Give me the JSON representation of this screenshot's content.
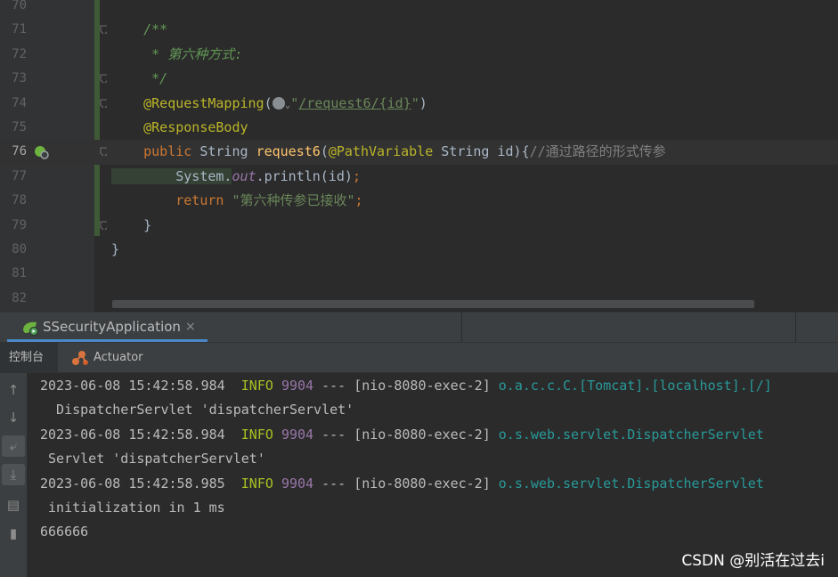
{
  "editor": {
    "lines": [
      {
        "num": "70",
        "parts": []
      },
      {
        "num": "71",
        "parts": [
          {
            "c": "cm",
            "t": "    /**"
          }
        ]
      },
      {
        "num": "72",
        "parts": [
          {
            "c": "cm",
            "t": "     * 第六种方式:"
          }
        ]
      },
      {
        "num": "73",
        "parts": [
          {
            "c": "cm",
            "t": "     */"
          }
        ]
      },
      {
        "num": "74",
        "parts": [
          {
            "c": "ann",
            "t": "    @RequestMapping"
          },
          {
            "c": "",
            "t": "("
          },
          {
            "c": "icon",
            "t": ""
          },
          {
            "c": "str",
            "t": "\""
          },
          {
            "c": "link",
            "t": "/request6/{id}"
          },
          {
            "c": "str",
            "t": "\""
          },
          {
            "c": "",
            "t": ")"
          }
        ]
      },
      {
        "num": "75",
        "parts": [
          {
            "c": "ann",
            "t": "    @ResponseBody"
          }
        ]
      },
      {
        "num": "76",
        "parts": [
          {
            "c": "kw",
            "t": "    public "
          },
          {
            "c": "",
            "t": "String "
          },
          {
            "c": "fn",
            "t": "request6"
          },
          {
            "c": "",
            "t": "("
          },
          {
            "c": "ann",
            "t": "@PathVariable "
          },
          {
            "c": "",
            "t": "String id){"
          },
          {
            "c": "lc",
            "t": "//通过路径的形式传参"
          }
        ]
      },
      {
        "num": "77",
        "parts": [
          {
            "c": "hl",
            "t": "        System."
          },
          {
            "c": "field",
            "t": "out"
          },
          {
            "c": "",
            "t": ".println(id)"
          },
          {
            "c": "kw",
            "t": ";"
          }
        ]
      },
      {
        "num": "78",
        "parts": [
          {
            "c": "kw",
            "t": "        return "
          },
          {
            "c": "str",
            "t": "\"第六种传参已接收\""
          },
          {
            "c": "kw",
            "t": ";"
          }
        ]
      },
      {
        "num": "79",
        "parts": [
          {
            "c": "",
            "t": "    }"
          }
        ]
      },
      {
        "num": "80",
        "parts": [
          {
            "c": "",
            "t": "}"
          }
        ]
      },
      {
        "num": "81",
        "parts": []
      },
      {
        "num": "82",
        "parts": []
      }
    ],
    "current_line": "76"
  },
  "run_tab": {
    "label": "SSecurityApplication",
    "close": "×"
  },
  "subtabs": {
    "console": "控制台",
    "actuator": "Actuator"
  },
  "console": {
    "lines": [
      [
        {
          "c": "ts",
          "t": "2023-06-08 15:42:58.984  "
        },
        {
          "c": "info",
          "t": "INFO "
        },
        {
          "c": "pid",
          "t": "9904"
        },
        {
          "c": "ts",
          "t": " --- [nio-8080-exec-2] "
        },
        {
          "c": "logger",
          "t": "o.a.c.c.C.[Tomcat].[localhost].[/]"
        }
      ],
      [
        {
          "c": "ts",
          "t": "  DispatcherServlet 'dispatcherServlet'"
        }
      ],
      [
        {
          "c": "ts",
          "t": "2023-06-08 15:42:58.984  "
        },
        {
          "c": "info",
          "t": "INFO "
        },
        {
          "c": "pid",
          "t": "9904"
        },
        {
          "c": "ts",
          "t": " --- [nio-8080-exec-2] "
        },
        {
          "c": "logger",
          "t": "o.s.web.servlet.DispatcherServlet"
        }
      ],
      [
        {
          "c": "ts",
          "t": " Servlet 'dispatcherServlet'"
        }
      ],
      [
        {
          "c": "ts",
          "t": "2023-06-08 15:42:58.985  "
        },
        {
          "c": "info",
          "t": "INFO "
        },
        {
          "c": "pid",
          "t": "9904"
        },
        {
          "c": "ts",
          "t": " --- [nio-8080-exec-2] "
        },
        {
          "c": "logger",
          "t": "o.s.web.servlet.DispatcherServlet"
        }
      ],
      [
        {
          "c": "ts",
          "t": " initialization in 1 ms"
        }
      ],
      [
        {
          "c": "ts",
          "t": "666666"
        }
      ]
    ]
  },
  "side_icons": [
    "up-arrow-icon",
    "down-arrow-icon",
    "soft-wrap-icon",
    "scroll-to-end-icon",
    "print-icon",
    "trash-icon"
  ],
  "watermark": "CSDN @别活在过去i",
  "colors": {
    "keyword": "#cc7832",
    "annotation": "#bbb529",
    "string": "#6a8759",
    "comment": "#629755",
    "info": "#a8c023",
    "logger": "#299999"
  }
}
